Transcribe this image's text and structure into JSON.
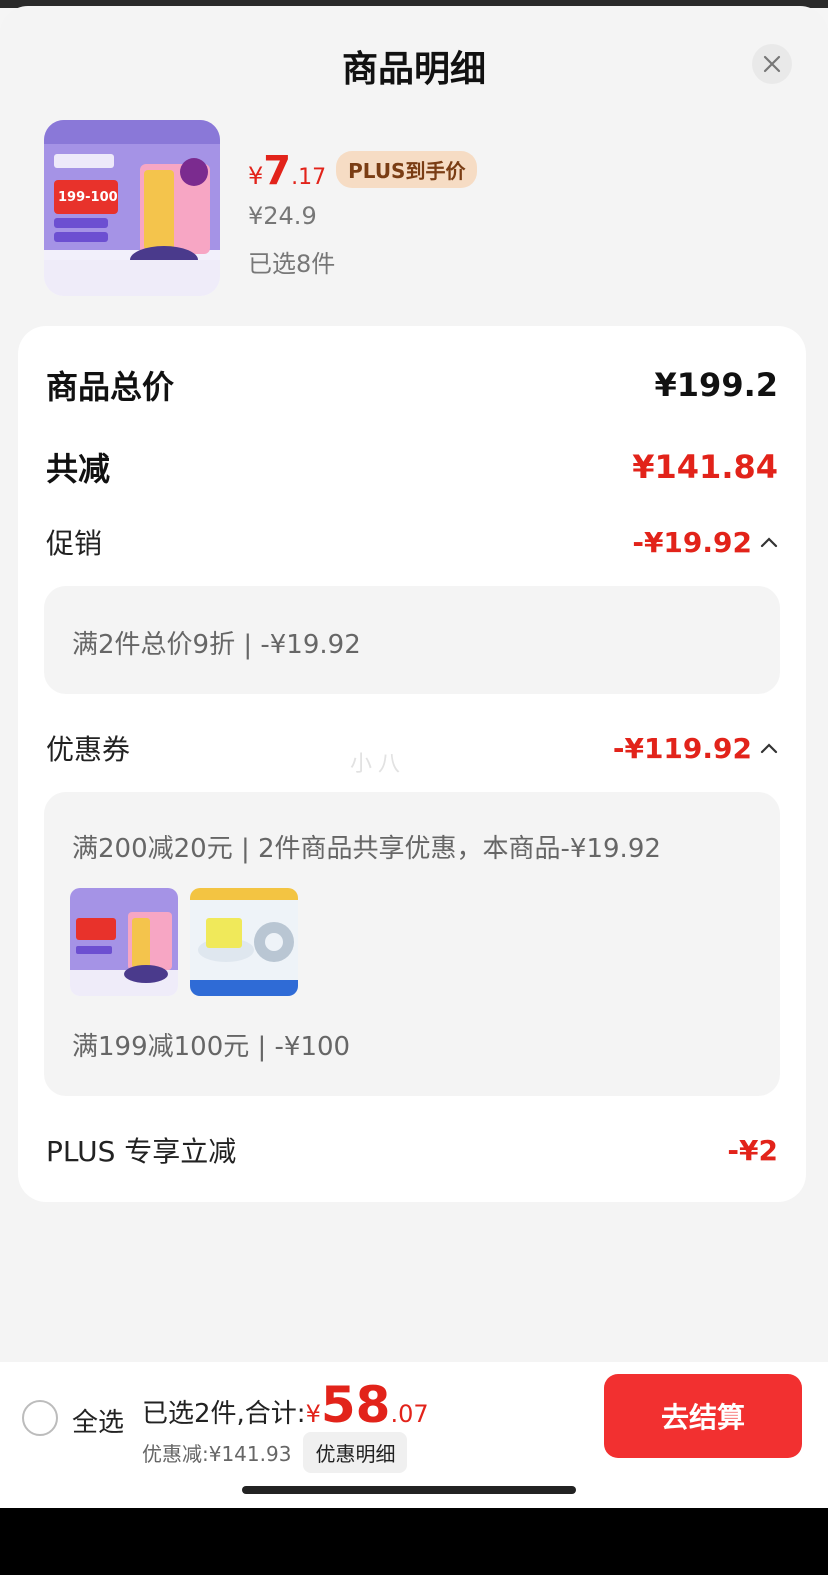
{
  "sheet": {
    "title": "商品明细"
  },
  "product": {
    "price_symbol": "¥",
    "price_int": "7",
    "price_dec": ".17",
    "plus_tag": "PLUS到手价",
    "original_price": "¥24.9",
    "selected_count": "已选8件",
    "thumb_badge": "199-100"
  },
  "summary": {
    "total_label": "商品总价",
    "total_value": "¥199.2",
    "reduce_label": "共减",
    "reduce_value": "¥141.84",
    "promo_label": "促销",
    "promo_value": "-¥19.92",
    "promo_detail": "满2件总价9折 | -¥19.92",
    "coupon_label": "优惠券",
    "coupon_value": "-¥119.92",
    "coupon_detail_1": "满200减20元 | 2件商品共享优惠，本商品-¥19.92",
    "coupon_detail_2": "满199减100元 | -¥100",
    "plus_label": "PLUS 专享立减",
    "plus_value": "-¥2"
  },
  "watermark": "小八",
  "bottom": {
    "select_all": "全选",
    "selected_summary": "已选2件,合计:",
    "total_symbol": "¥",
    "total_int": "58",
    "total_dec": ".07",
    "discount_text": "优惠减:¥141.93",
    "detail_button": "优惠明细",
    "checkout_button": "去结算"
  },
  "colors": {
    "accent_red": "#e2231a",
    "checkout_red": "#f23030",
    "plus_tag_bg": "#f6dcc4"
  }
}
